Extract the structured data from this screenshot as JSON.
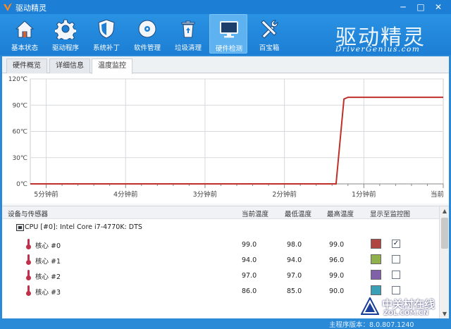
{
  "window": {
    "title": "驱动精灵",
    "min": "─",
    "max": "□",
    "close": "✕"
  },
  "toolbar": {
    "items": [
      {
        "label": "基本状态",
        "icon": "home-icon"
      },
      {
        "label": "驱动程序",
        "icon": "gear-icon"
      },
      {
        "label": "系统补丁",
        "icon": "shield-icon"
      },
      {
        "label": "软件管理",
        "icon": "disc-icon"
      },
      {
        "label": "垃圾清理",
        "icon": "recycle-bin-icon"
      },
      {
        "label": "硬件检测",
        "icon": "monitor-icon",
        "active": true
      },
      {
        "label": "百宝箱",
        "icon": "tools-icon"
      }
    ]
  },
  "brand": {
    "name_cn": "驱动精灵",
    "name_en": "DriverGenius.com"
  },
  "tabs": [
    {
      "label": "硬件概览",
      "active": false
    },
    {
      "label": "详细信息",
      "active": false
    },
    {
      "label": "温度监控",
      "active": true
    }
  ],
  "chart_data": {
    "type": "line",
    "title": "",
    "xlabel": "",
    "ylabel": "",
    "yticks": [
      "120℃",
      "90℃",
      "60℃",
      "30℃",
      "0℃"
    ],
    "ylim": [
      0,
      120
    ],
    "xticks": [
      "5分钟前",
      "4分钟前",
      "3分钟前",
      "2分钟前",
      "1分钟前",
      "当前"
    ],
    "xlim": [
      -5.2,
      0
    ],
    "grid": true,
    "series": [
      {
        "color": "#c0302a",
        "x": [
          -5.2,
          -1.35,
          -1.25,
          -1.2,
          0
        ],
        "y": [
          0,
          0,
          97,
          99,
          99
        ]
      }
    ]
  },
  "table": {
    "headers": {
      "name": "设备与传感器",
      "current": "当前温度",
      "min": "最低温度",
      "max": "最高温度",
      "show": "显示至监控图"
    },
    "device": "CPU [#0]: Intel Core i7-4770K: DTS",
    "rows": [
      {
        "name": "核心 #0",
        "current": "99.0",
        "min": "98.0",
        "max": "99.0",
        "color": "#b04440",
        "checked": true
      },
      {
        "name": "核心 #1",
        "current": "94.0",
        "min": "94.0",
        "max": "96.0",
        "color": "#8fb04a",
        "checked": false
      },
      {
        "name": "核心 #2",
        "current": "97.0",
        "min": "97.0",
        "max": "99.0",
        "color": "#8060a8",
        "checked": false
      },
      {
        "name": "核心 #3",
        "current": "86.0",
        "min": "85.0",
        "max": "90.0",
        "color": "#3aa0b8",
        "checked": false
      }
    ],
    "check_mark": "✓"
  },
  "status": {
    "version": "主程序版本：8.0.807.1240"
  },
  "watermark": {
    "cn": "中关村在线",
    "en": "ZOL.COM.CN"
  }
}
